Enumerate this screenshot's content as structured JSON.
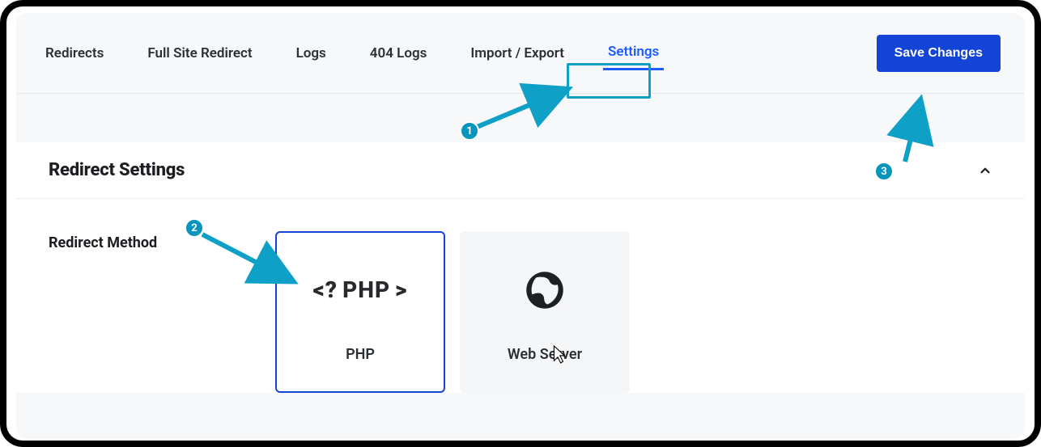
{
  "tabs": {
    "redirects": "Redirects",
    "full_site": "Full Site Redirect",
    "logs": "Logs",
    "logs404": "404 Logs",
    "import_export": "Import / Export",
    "settings": "Settings"
  },
  "save_button": "Save Changes",
  "panel": {
    "title": "Redirect Settings",
    "redirect_method_label": "Redirect Method"
  },
  "options": {
    "php": {
      "glyph_left": "<?",
      "glyph_text": "PHP",
      "glyph_right": ">",
      "label": "PHP"
    },
    "webserver": {
      "label": "Web Server"
    }
  },
  "callouts": {
    "one": "1",
    "two": "2",
    "three": "3"
  }
}
